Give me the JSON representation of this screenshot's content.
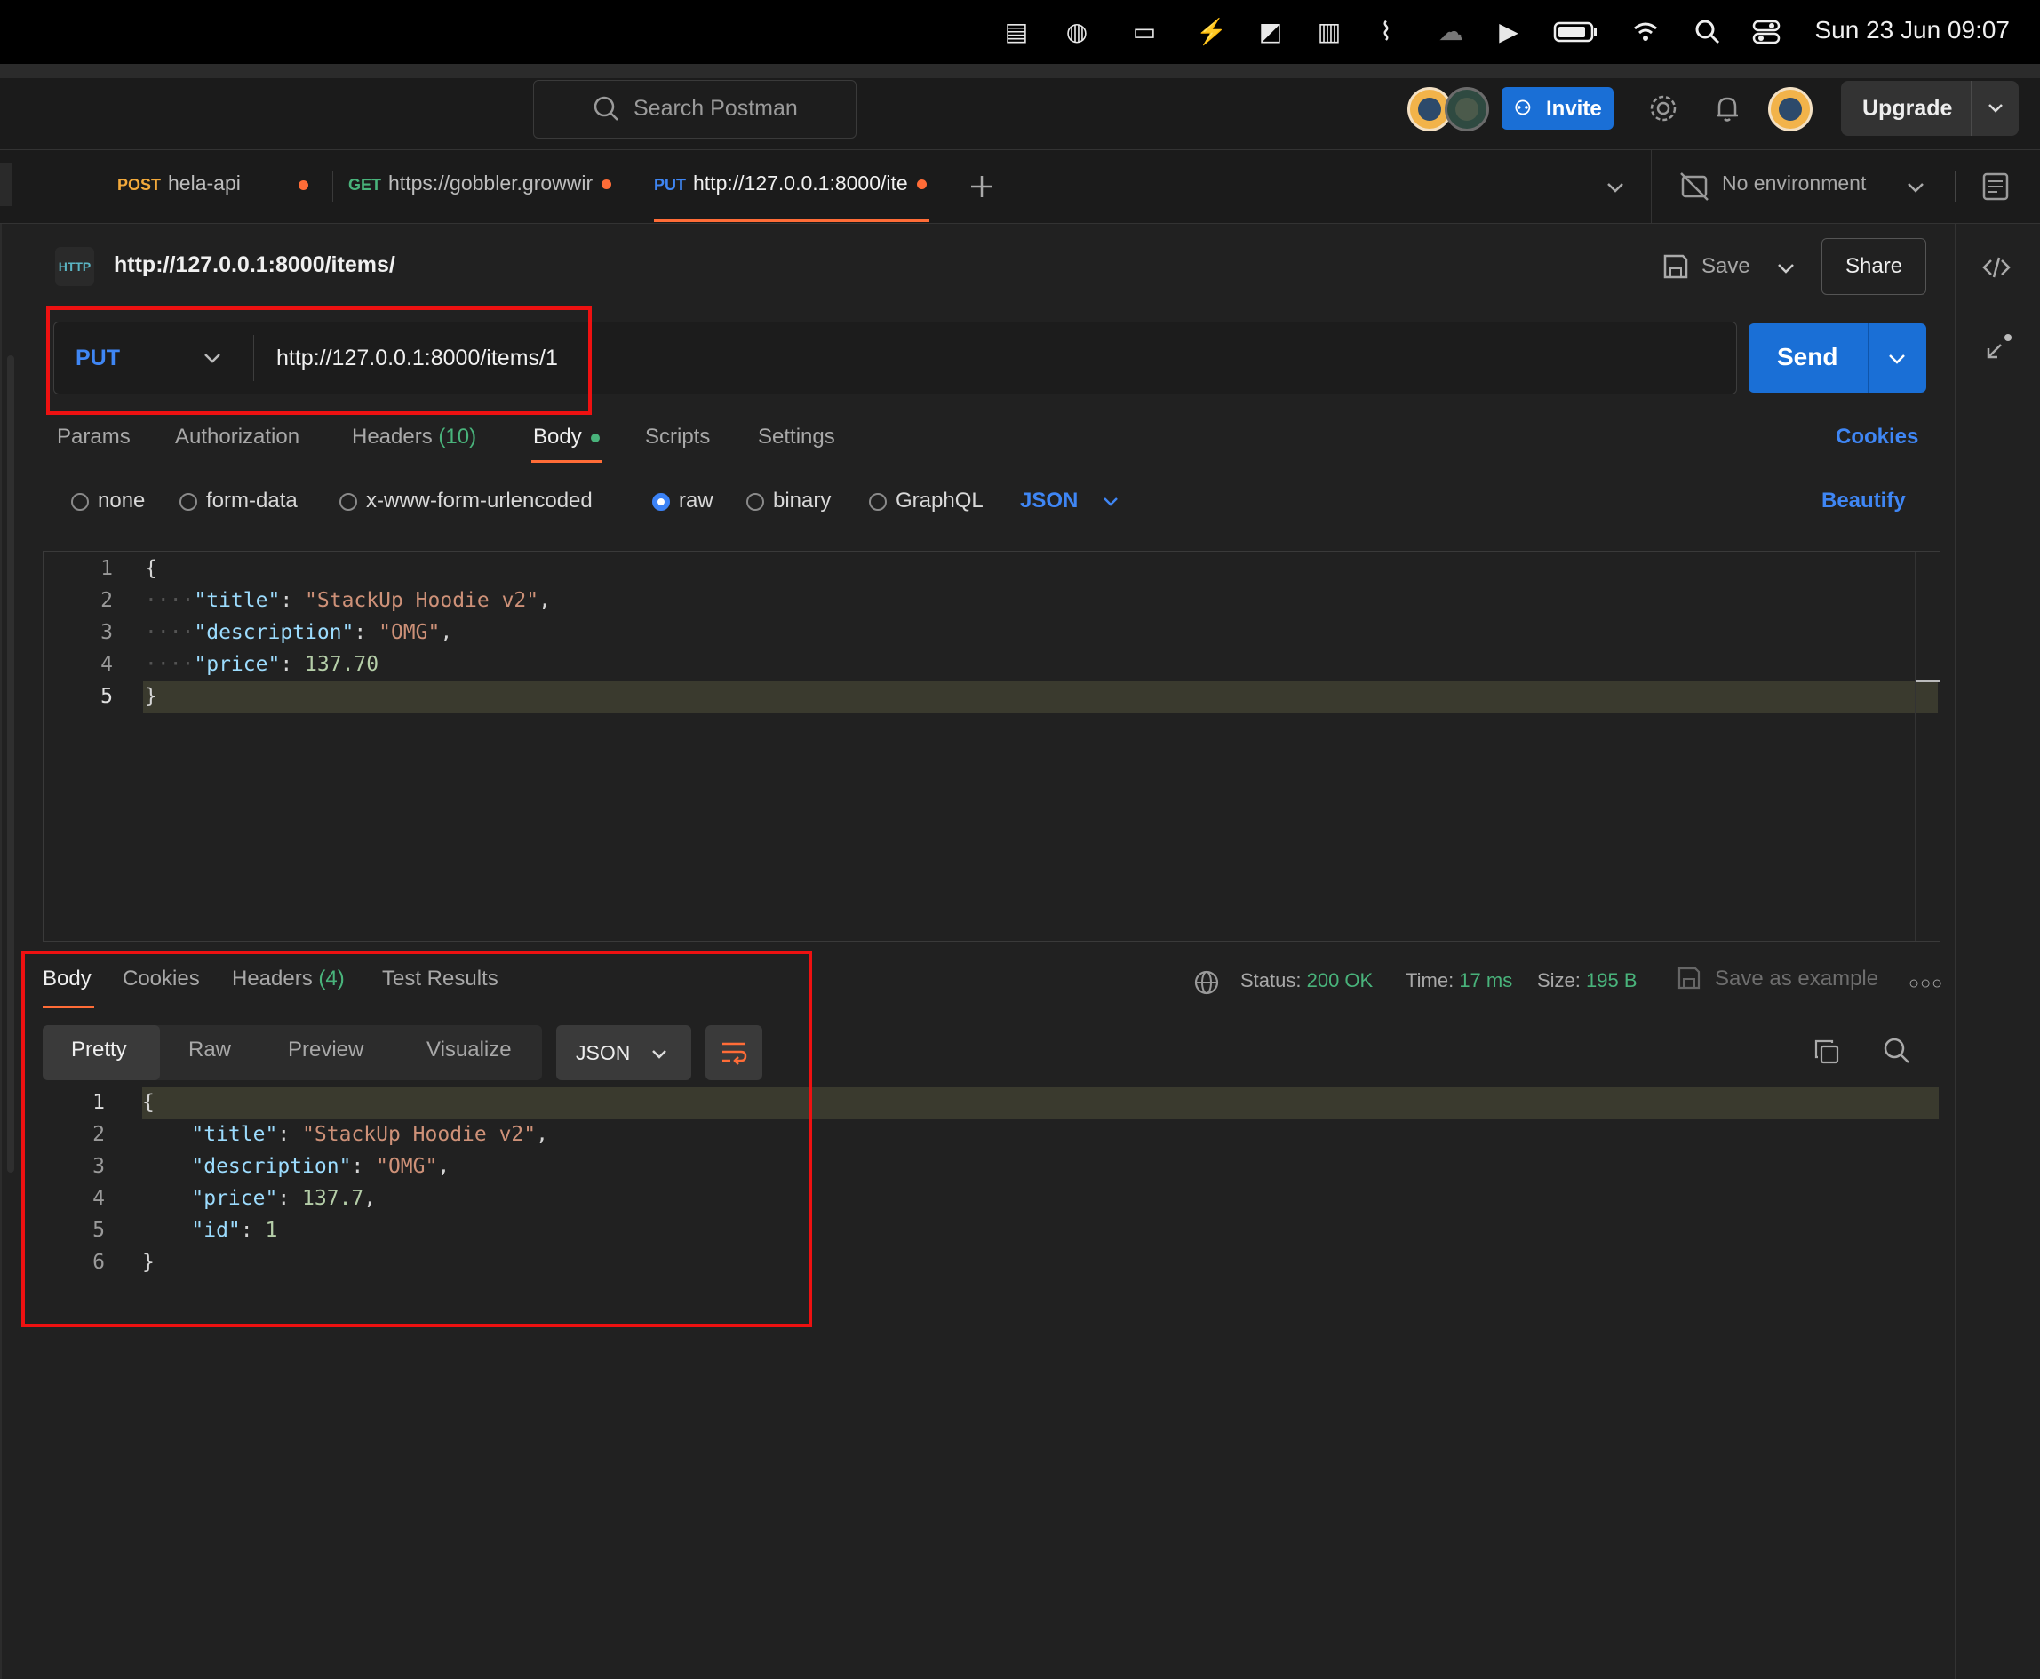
{
  "menubar": {
    "clock": "Sun 23 Jun  09:07"
  },
  "header": {
    "search_placeholder": "Search Postman",
    "invite_label": "Invite",
    "upgrade_label": "Upgrade"
  },
  "tabs": [
    {
      "method": "POST",
      "label": "hela-api"
    },
    {
      "method": "GET",
      "label": "https://gobbler.growwir"
    },
    {
      "method": "PUT",
      "label": "http://127.0.0.1:8000/ite"
    }
  ],
  "environment": {
    "label": "No environment"
  },
  "request": {
    "title": "http://127.0.0.1:8000/items/",
    "save_label": "Save",
    "share_label": "Share",
    "method": "PUT",
    "url": "http://127.0.0.1:8000/items/1",
    "send_label": "Send",
    "subtabs": {
      "params": "Params",
      "authorization": "Authorization",
      "headers": "Headers",
      "headers_count": "(10)",
      "body": "Body",
      "scripts": "Scripts",
      "settings": "Settings",
      "cookies": "Cookies"
    },
    "body_types": {
      "none": "none",
      "form_data": "form-data",
      "urlencoded": "x-www-form-urlencoded",
      "raw": "raw",
      "binary": "binary",
      "graphql": "GraphQL",
      "format": "JSON",
      "beautify": "Beautify"
    },
    "body_lines": [
      "1",
      "2",
      "3",
      "4",
      "5"
    ],
    "body_code": {
      "open": "{",
      "k1": "\"title\"",
      "v1": "\"StackUp Hoodie v2\"",
      "k2": "\"description\"",
      "v2": "\"OMG\"",
      "k3": "\"price\"",
      "v3": "137.70",
      "close": "}"
    }
  },
  "response": {
    "tabs": {
      "body": "Body",
      "cookies": "Cookies",
      "headers": "Headers",
      "headers_count": "(4)",
      "tests": "Test Results"
    },
    "status_label": "Status:",
    "status_value": "200 OK",
    "time_label": "Time:",
    "time_value": "17 ms",
    "size_label": "Size:",
    "size_value": "195 B",
    "save_example": "Save as example",
    "views": {
      "pretty": "Pretty",
      "raw": "Raw",
      "preview": "Preview",
      "visualize": "Visualize",
      "format": "JSON"
    },
    "lines": [
      "1",
      "2",
      "3",
      "4",
      "5",
      "6"
    ],
    "code": {
      "open": "{",
      "k1": "\"title\"",
      "v1": "\"StackUp Hoodie v2\"",
      "k2": "\"description\"",
      "v2": "\"OMG\"",
      "k3": "\"price\"",
      "v3": "137.7",
      "k4": "\"id\"",
      "v4": "1",
      "close": "}"
    }
  }
}
